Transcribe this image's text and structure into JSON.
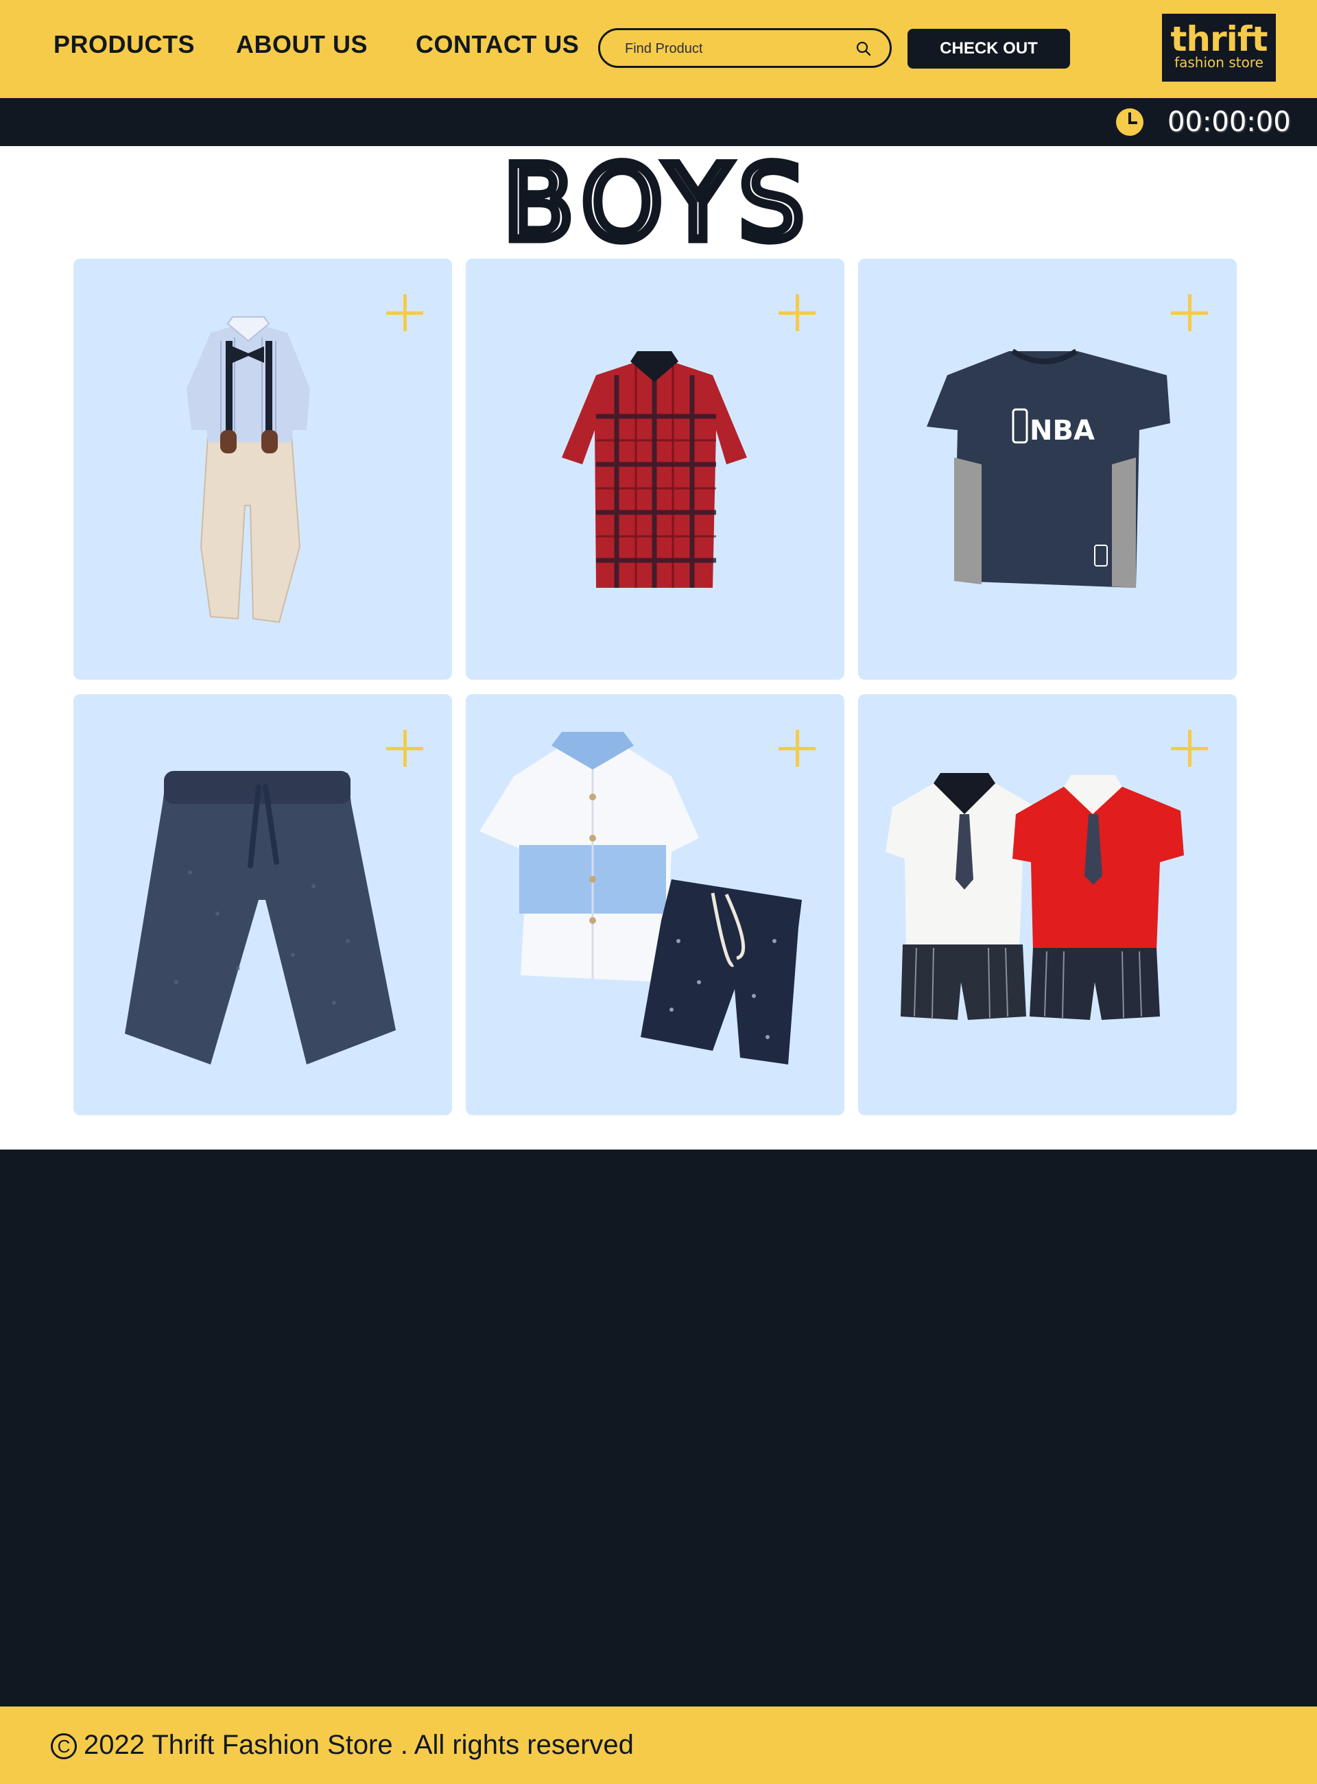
{
  "header": {
    "nav": [
      {
        "label": "PRODUCTS"
      },
      {
        "label": "ABOUT US"
      },
      {
        "label": "CONTACT US"
      }
    ],
    "search": {
      "placeholder": "Find Product",
      "value": ""
    },
    "checkout_label": "CHECK OUT",
    "logo": {
      "word": "thrift",
      "tagline": "fashion store"
    }
  },
  "timer": {
    "value": "00:00:00",
    "icon": "clock-icon"
  },
  "section": {
    "title": "BOYS"
  },
  "products": [
    {
      "name": "shirt-suspenders-pants-set",
      "icon": "plus-icon"
    },
    {
      "name": "red-plaid-shirt",
      "icon": "plus-icon"
    },
    {
      "name": "nba-navy-tshirt",
      "icon": "plus-icon"
    },
    {
      "name": "navy-shorts",
      "icon": "plus-icon"
    },
    {
      "name": "striped-shirt-and-shorts-set",
      "icon": "plus-icon"
    },
    {
      "name": "sailor-tshirt-shorts-sets",
      "icon": "plus-icon"
    }
  ],
  "footer": {
    "copyright_symbol": "C",
    "text": "2022 Thrift Fashion Store . All rights reserved"
  },
  "colors": {
    "brand_yellow": "#f6cb4a",
    "dark": "#121821",
    "card_bg": "#d3e8fe"
  }
}
